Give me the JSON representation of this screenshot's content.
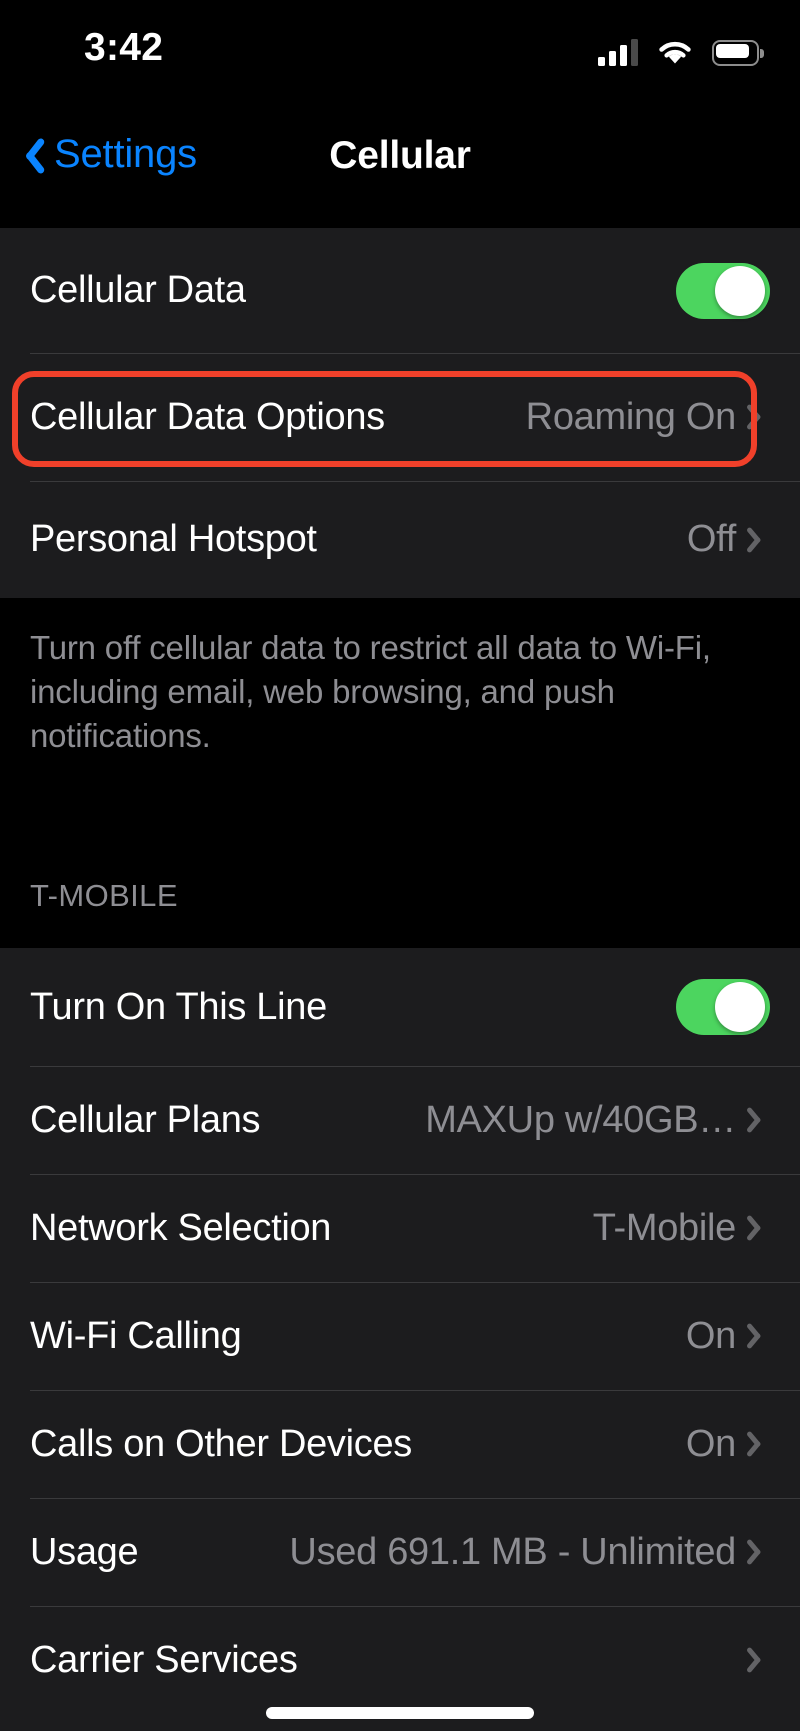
{
  "status_bar": {
    "time": "3:42",
    "cellular_icon": "cellular-signal-icon",
    "cellular_bars_filled": 3,
    "cellular_bars_total": 4,
    "wifi_icon": "wifi-icon",
    "battery_icon": "battery-icon",
    "battery_level_percent": 80
  },
  "nav": {
    "back_label": "Settings",
    "back_icon": "chevron-left-icon",
    "title": "Cellular"
  },
  "sections": [
    {
      "id": "cellular-main",
      "rows": [
        {
          "label": "Cellular Data",
          "type": "toggle",
          "value": "",
          "toggle_on": true
        },
        {
          "label": "Cellular Data Options",
          "type": "disclosure",
          "value": "Roaming On",
          "highlighted": true
        },
        {
          "label": "Personal Hotspot",
          "type": "disclosure",
          "value": "Off",
          "highlighted": false
        }
      ],
      "footnote": "Turn off cellular data to restrict all data to Wi-Fi, including email, web browsing, and push notifications."
    },
    {
      "id": "carrier-line",
      "header": "T-MOBILE",
      "rows": [
        {
          "label": "Turn On This Line",
          "type": "toggle",
          "value": "",
          "toggle_on": true
        },
        {
          "label": "Cellular Plans",
          "type": "disclosure",
          "value": "MAXUp w/40GB…"
        },
        {
          "label": "Network Selection",
          "type": "disclosure",
          "value": "T-Mobile"
        },
        {
          "label": "Wi-Fi Calling",
          "type": "disclosure",
          "value": "On"
        },
        {
          "label": "Calls on Other Devices",
          "type": "disclosure",
          "value": "On"
        },
        {
          "label": "Usage",
          "type": "disclosure",
          "value": "Used 691.1 MB - Unlimited"
        },
        {
          "label": "Carrier Services",
          "type": "disclosure",
          "value": ""
        }
      ]
    }
  ],
  "annotation": {
    "target_label": "Cellular Data Options",
    "highlight_color": "#f0402a"
  },
  "colors": {
    "background": "#000000",
    "cell_background": "#1c1c1e",
    "separator": "#3a3a3c",
    "primary_text": "#ffffff",
    "secondary_text": "#8e8e93",
    "tint_blue": "#0a84ff",
    "toggle_on_green": "#4cd55f",
    "highlight_red": "#f0402a"
  }
}
